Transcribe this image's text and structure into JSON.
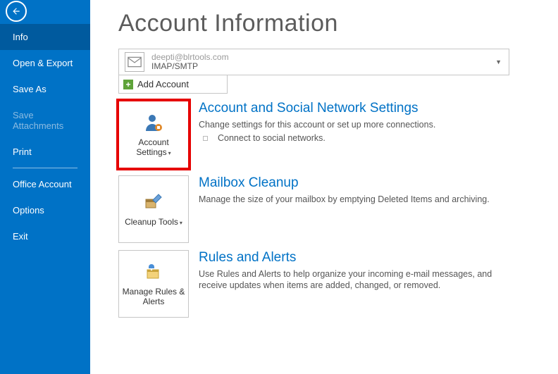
{
  "sidebar": {
    "items": [
      {
        "label": "Info",
        "active": true
      },
      {
        "label": "Open & Export"
      },
      {
        "label": "Save As"
      },
      {
        "label": "Save Attachments",
        "disabled": true
      },
      {
        "label": "Print"
      }
    ],
    "lower": [
      {
        "label": "Office Account"
      },
      {
        "label": "Options"
      },
      {
        "label": "Exit"
      }
    ]
  },
  "page_title": "Account Information",
  "account": {
    "email": "deepti@blrtools.com",
    "protocol": "IMAP/SMTP"
  },
  "add_account_label": "Add Account",
  "sections": [
    {
      "tile_label": "Account Settings",
      "has_dropdown": true,
      "highlight": true,
      "title": "Account and Social Network Settings",
      "desc": "Change settings for this account or set up more connections.",
      "sub": "Connect to social networks.",
      "icon": "account-settings-icon"
    },
    {
      "tile_label": "Cleanup Tools",
      "has_dropdown": true,
      "title": "Mailbox Cleanup",
      "desc": "Manage the size of your mailbox by emptying Deleted Items and archiving.",
      "icon": "cleanup-tools-icon"
    },
    {
      "tile_label": "Manage Rules & Alerts",
      "has_dropdown": false,
      "title": "Rules and Alerts",
      "desc": "Use Rules and Alerts to help organize your incoming e-mail messages, and receive updates when items are added, changed, or removed.",
      "icon": "rules-alerts-icon"
    }
  ]
}
